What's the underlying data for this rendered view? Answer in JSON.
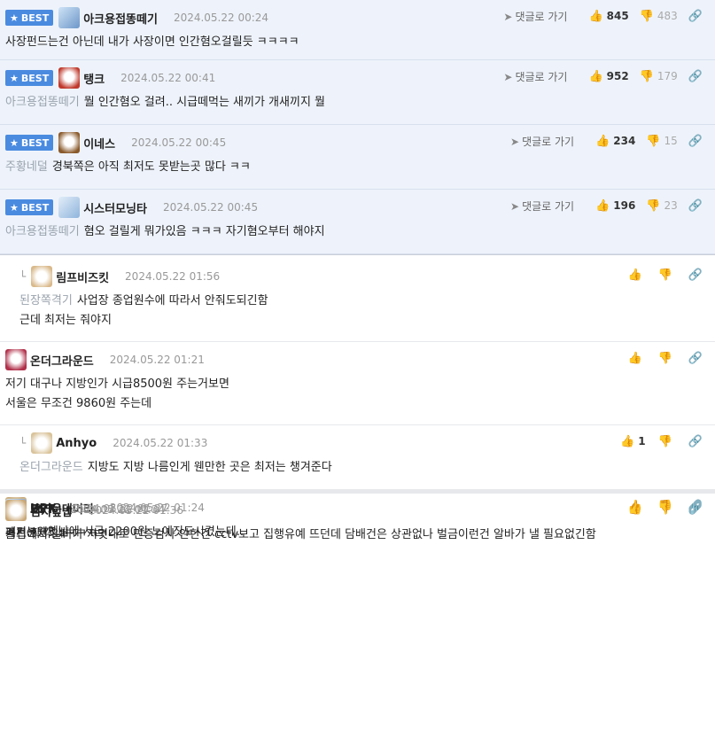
{
  "labels": {
    "best": "BEST",
    "goto_reply": "댓글로 가기"
  },
  "comments": [
    {
      "nick": "아크용접똥떼기",
      "date": "2024.05.22 00:24",
      "to": "",
      "text": "사장펀드는건 아닌데 내가 사장이면 인간혐오걸릴듯 ㅋㅋㅋㅋ",
      "up": "845",
      "down": "483"
    },
    {
      "nick": "탱크",
      "date": "2024.05.22 00:41",
      "to": "아크용접똥떼기",
      "text": "뭘 인간혐오 걸려.. 시급떼먹는 새끼가 개새끼지 뭘",
      "up": "952",
      "down": "179"
    },
    {
      "nick": "이네스",
      "date": "2024.05.22 00:45",
      "to": "주황네덜",
      "text": "경북쪽은 아직 최저도 못받는곳 많다 ㅋㅋ",
      "up": "234",
      "down": "15"
    },
    {
      "nick": "시스터모닝타",
      "date": "2024.05.22 00:45",
      "to": "아크용접똥떼기",
      "text": "혐오 걸릴게 뭐가있음 ㅋㅋㅋ 자기혐오부터 해야지",
      "up": "196",
      "down": "23"
    },
    {
      "nick": "림프비즈킷",
      "date": "2024.05.22 01:56",
      "to": "된장쪽격기",
      "text": "사업장 종업원수에 따라서 안줘도되긴함",
      "text2": "근데 최저는 줘야지",
      "up": "",
      "down": ""
    },
    {
      "nick": "온더그라운드",
      "date": "2024.05.22 01:21",
      "to": "",
      "text": "저기 대구나 지방인가 시급8500원 주는거보면",
      "text2": "서울은 무조건 9860원 주는데",
      "up": "",
      "down": ""
    },
    {
      "nick": "Anhyo",
      "date": "2024.05.22 01:33",
      "to": "온더그라운드",
      "text": "지방도 지방 나름인게 웬만한 곳은 최저는 챙겨준다",
      "up": "1",
      "down": ""
    },
    {
      "nick": "뜨거운대머리",
      "date": "2024.05.22 01:24",
      "to": "",
      "text": "ㅋㅋㅋㅋ옛날에 시급 2200원 노예짓도시켰눈데..",
      "up": "",
      "down": ""
    },
    {
      "nick": "UPX",
      "date": "2024.05.22 01:27",
      "to": "",
      "text": "폐기는웽?",
      "up": "",
      "down": ""
    },
    {
      "nick": "EST",
      "date": "2024.05.22 01:34",
      "to": "",
      "text": "커브 확 꺾네ㅋㅋㅋㅋ",
      "up": "",
      "down": ""
    },
    {
      "nick": "김치덮밥",
      "date": "2024.05.22 01:36",
      "to": "",
      "text": "술집에서 알바가 지멋대로 민증검사 안한건 cctv보고 집행유예 뜨던데 담배건은 상관없나 벌금이런건 알바가 낼 필요없긴함",
      "up": "",
      "down": ""
    }
  ],
  "colors": {
    "accent": "#4a8be0",
    "best_bg": "#eef3fb"
  },
  "icons": [
    "star-icon",
    "paper-plane-icon",
    "thumbs-up-icon",
    "thumbs-down-icon",
    "link-icon",
    "reply-arrow-icon",
    "avatar-icon"
  ]
}
